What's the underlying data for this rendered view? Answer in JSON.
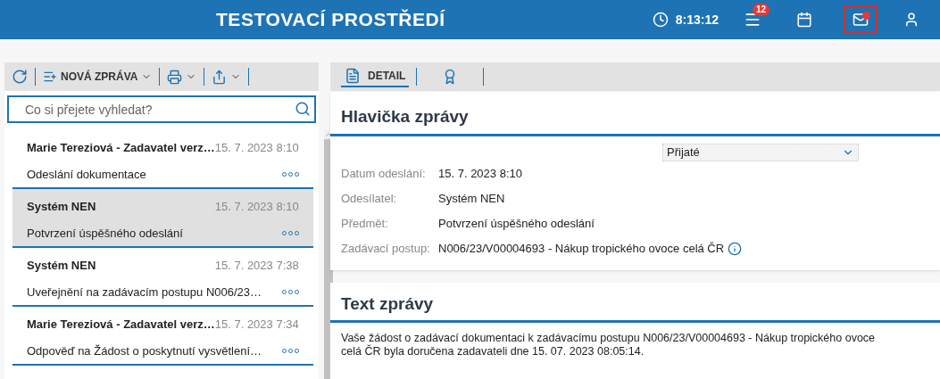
{
  "header": {
    "title": "TESTOVACÍ PROSTŘEDÍ",
    "time": "8:13:12",
    "menu_badge": "12",
    "mail": {
      "selected": true,
      "unread": true
    }
  },
  "list_toolbar": {
    "new_message": "NOVÁ ZPRÁVA"
  },
  "search": {
    "placeholder": "Co si přejete vyhledat?"
  },
  "messages": [
    {
      "sender": "Marie Tereziová - Zadavatel verz…",
      "date": "15. 7. 2023 8:10",
      "subject": "Odeslání dokumentace",
      "selected": false
    },
    {
      "sender": "Systém NEN",
      "date": "15. 7. 2023 8:10",
      "subject": "Potvrzení úspěšného odeslání",
      "selected": true
    },
    {
      "sender": "Systém NEN",
      "date": "15. 7. 2023 7:38",
      "subject": "Uveřejnění na zadávacím postupu N006/23…",
      "selected": false
    },
    {
      "sender": "Marie Tereziová - Zadavatel verz…",
      "date": "15. 7. 2023 7:34",
      "subject": "Odpověď na Žádost o poskytnutí vysvětlení…",
      "selected": false
    }
  ],
  "detail_tabs": [
    {
      "kind": "text",
      "label": "DETAIL",
      "selected": true
    },
    {
      "kind": "icon",
      "selected": false
    }
  ],
  "header_section": {
    "title": "Hlavička zprávy",
    "folder": "Přijaté",
    "fields": [
      {
        "label": "Datum odeslání:",
        "value": "15. 7. 2023 8:10",
        "info": false
      },
      {
        "label": "Odesílatel:",
        "value": "Systém NEN",
        "info": false
      },
      {
        "label": "Předmět:",
        "value": "Potvrzení úspěšného odeslání",
        "info": false
      },
      {
        "label": "Zadávací postup:",
        "value": "N006/23/V00004693 - Nákup tropického ovoce celá ČR",
        "info": true
      }
    ]
  },
  "text_section": {
    "title": "Text zprávy",
    "body": "Vaše žádost o zadávací dokumentaci k zadávacímu postupu N006/23/V00004693 - Nákup tropického ovoce celá ČR byla doručena zadavateli dne 15. 07. 2023 08:05:14."
  }
}
